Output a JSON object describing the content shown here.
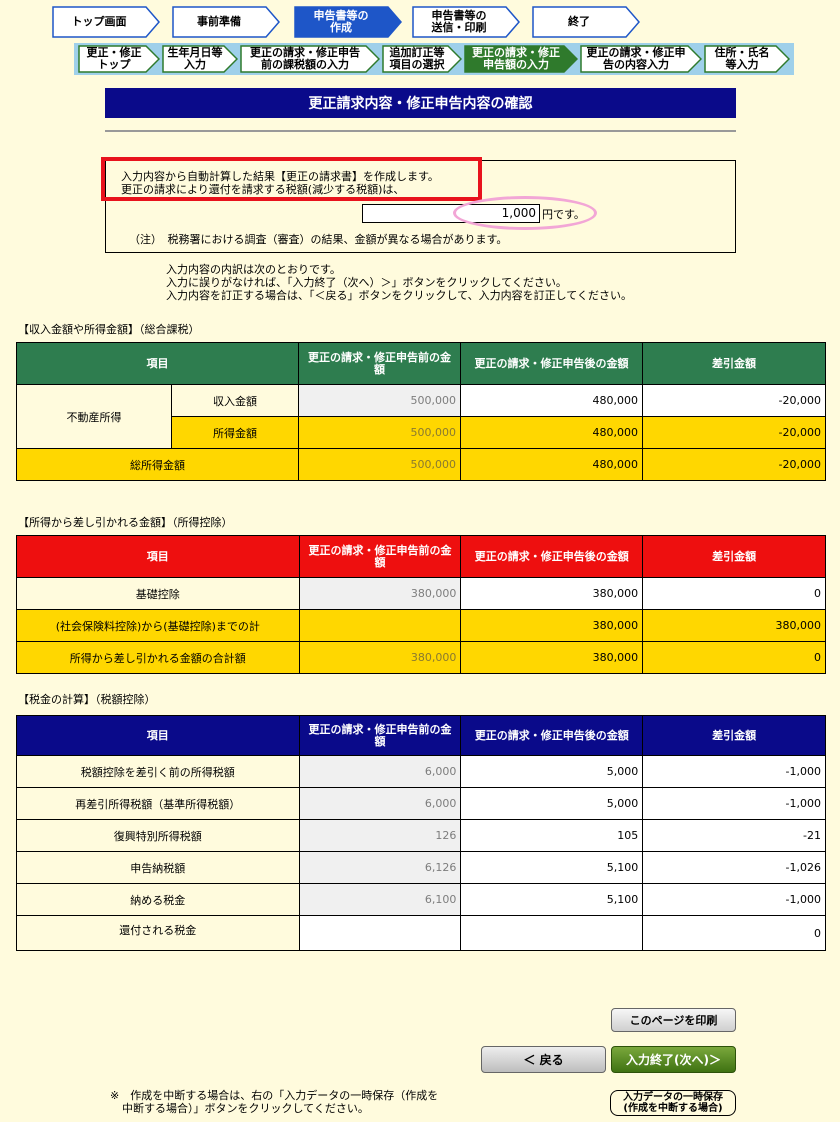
{
  "main_steps": [
    {
      "label": "トップ画面",
      "state": "done"
    },
    {
      "label": "事前準備",
      "state": "done"
    },
    {
      "label": "申告書等の\n作成",
      "state": "current"
    },
    {
      "label": "申告書等の\n送信・印刷",
      "state": "todo"
    },
    {
      "label": "終了",
      "state": "todo"
    }
  ],
  "sub_steps": [
    {
      "label": "更正・修正\nトップ",
      "state": "done"
    },
    {
      "label": "生年月日等\n入力",
      "state": "done"
    },
    {
      "label": "更正の請求・修正申告\n前の課税額の入力",
      "state": "done"
    },
    {
      "label": "追加訂正等\n項目の選択",
      "state": "done"
    },
    {
      "label": "更正の請求・修正\n申告額の入力",
      "state": "current"
    },
    {
      "label": "更正の請求・修正申\n告の内容入力",
      "state": "todo"
    },
    {
      "label": "住所・氏名\n等入力",
      "state": "todo"
    }
  ],
  "page_title": "更正請求内容・修正申告内容の確認",
  "info": {
    "line1": "入力内容から自動計算した結果【更正の請求書】を作成します。",
    "line2": "更正の請求により還付を請求する税額(減少する税額)は、",
    "amount": "1,000",
    "amount_unit": "円です。",
    "note": "（注）　税務署における調査（審査）の結果、金額が異なる場合があります。"
  },
  "guide": {
    "line1": "入力内容の内訳は次のとおりです。",
    "line2": "入力に誤りがなければ、「入力終了（次へ）＞」ボタンをクリックしてください。",
    "line3": "入力内容を訂正する場合は、「＜戻る」ボタンをクリックして、入力内容を訂正してください。"
  },
  "headers": {
    "item": "項目",
    "before": "更正の請求・修正申告前の金額",
    "after": "更正の請求・修正申告後の金額",
    "diff": "差引金額"
  },
  "colors": {
    "income": "#2e7d4f",
    "deduction": "#ee0f0f",
    "tax": "#0a0a8a",
    "yellow": "#ffd700"
  },
  "income": {
    "title": "【収入金額や所得金額】（総合課税）",
    "group_label": "不動産所得",
    "rows": [
      {
        "label": "収入金額",
        "before": "500,000",
        "after": "480,000",
        "diff": "-20,000"
      },
      {
        "label": "所得金額",
        "before": "500,000",
        "after": "480,000",
        "diff": "-20,000"
      }
    ],
    "total": {
      "label": "総所得金額",
      "before": "500,000",
      "after": "480,000",
      "diff": "-20,000"
    }
  },
  "deduction": {
    "title": "【所得から差し引かれる金額】（所得控除）",
    "rows": [
      {
        "label": "基礎控除",
        "before": "380,000",
        "after": "380,000",
        "diff": "0"
      },
      {
        "label": "(社会保険料控除)から(基礎控除)までの計",
        "before": "",
        "after": "380,000",
        "diff": "380,000"
      },
      {
        "label": "所得から差し引かれる金額の合計額",
        "before": "380,000",
        "after": "380,000",
        "diff": "0"
      }
    ]
  },
  "tax": {
    "title": "【税金の計算】（税額控除）",
    "rows": [
      {
        "label": "税額控除を差引く前の所得税額",
        "before": "6,000",
        "after": "5,000",
        "diff": "-1,000"
      },
      {
        "label": "再差引所得税額（基準所得税額）",
        "before": "6,000",
        "after": "5,000",
        "diff": "-1,000"
      },
      {
        "label": "復興特別所得税額",
        "before": "126",
        "after": "105",
        "diff": "-21"
      },
      {
        "label": "申告納税額",
        "before": "6,126",
        "after": "5,100",
        "diff": "-1,026"
      },
      {
        "label": "納める税金",
        "before": "6,100",
        "after": "5,100",
        "diff": "-1,000"
      },
      {
        "label": "還付される税金",
        "before": "",
        "after": "",
        "diff": "0"
      }
    ]
  },
  "buttons": {
    "print": "このページを印刷",
    "back": "＜ 戻る",
    "next": "入力終了(次へ)＞",
    "save_line1": "入力データの一時保存",
    "save_line2": "(作成を中断する場合)"
  },
  "footer": {
    "line1": "※　作成を中断する場合は、右の「入力データの一時保存（作成を",
    "line2": "中断する場合）」ボタンをクリックしてください。"
  }
}
